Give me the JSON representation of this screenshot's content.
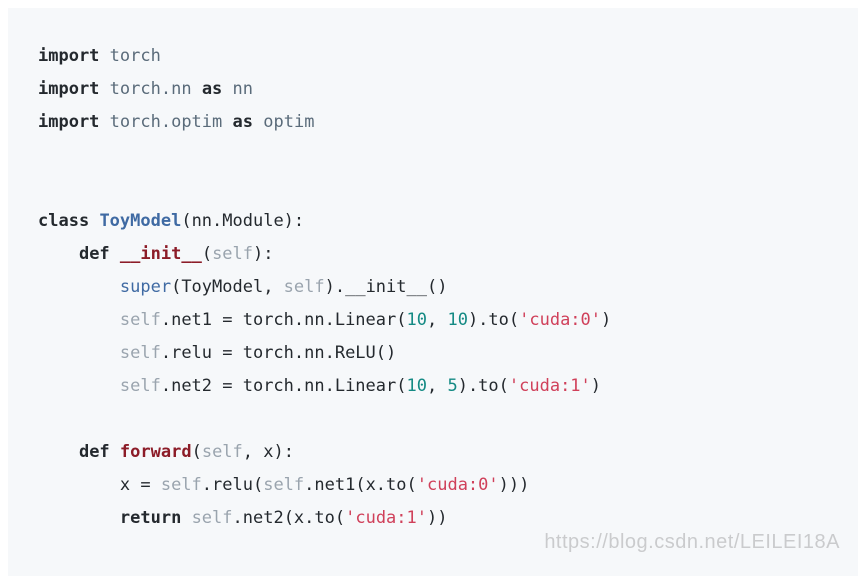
{
  "code": {
    "language": "python",
    "lines": [
      "import torch",
      "import torch.nn as nn",
      "import torch.optim as optim",
      "",
      "",
      "class ToyModel(nn.Module):",
      "    def __init__(self):",
      "        super(ToyModel, self).__init__()",
      "        self.net1 = torch.nn.Linear(10, 10).to('cuda:0')",
      "        self.relu = torch.nn.ReLU()",
      "        self.net2 = torch.nn.Linear(10, 5).to('cuda:1')",
      "",
      "    def forward(self, x):",
      "        x = self.relu(self.net1(x.to('cuda:0')))",
      "        return self.net2(x.to('cuda:1'))"
    ]
  },
  "watermark": "https://blog.csdn.net/LEILEI18A",
  "colors": {
    "background": "#f6f8fa",
    "keyword": "#24292e",
    "class_name": "#3f6aa3",
    "function_name": "#8c1c28",
    "self": "#9aa4ae",
    "number": "#148a84",
    "string": "#d0405a"
  }
}
